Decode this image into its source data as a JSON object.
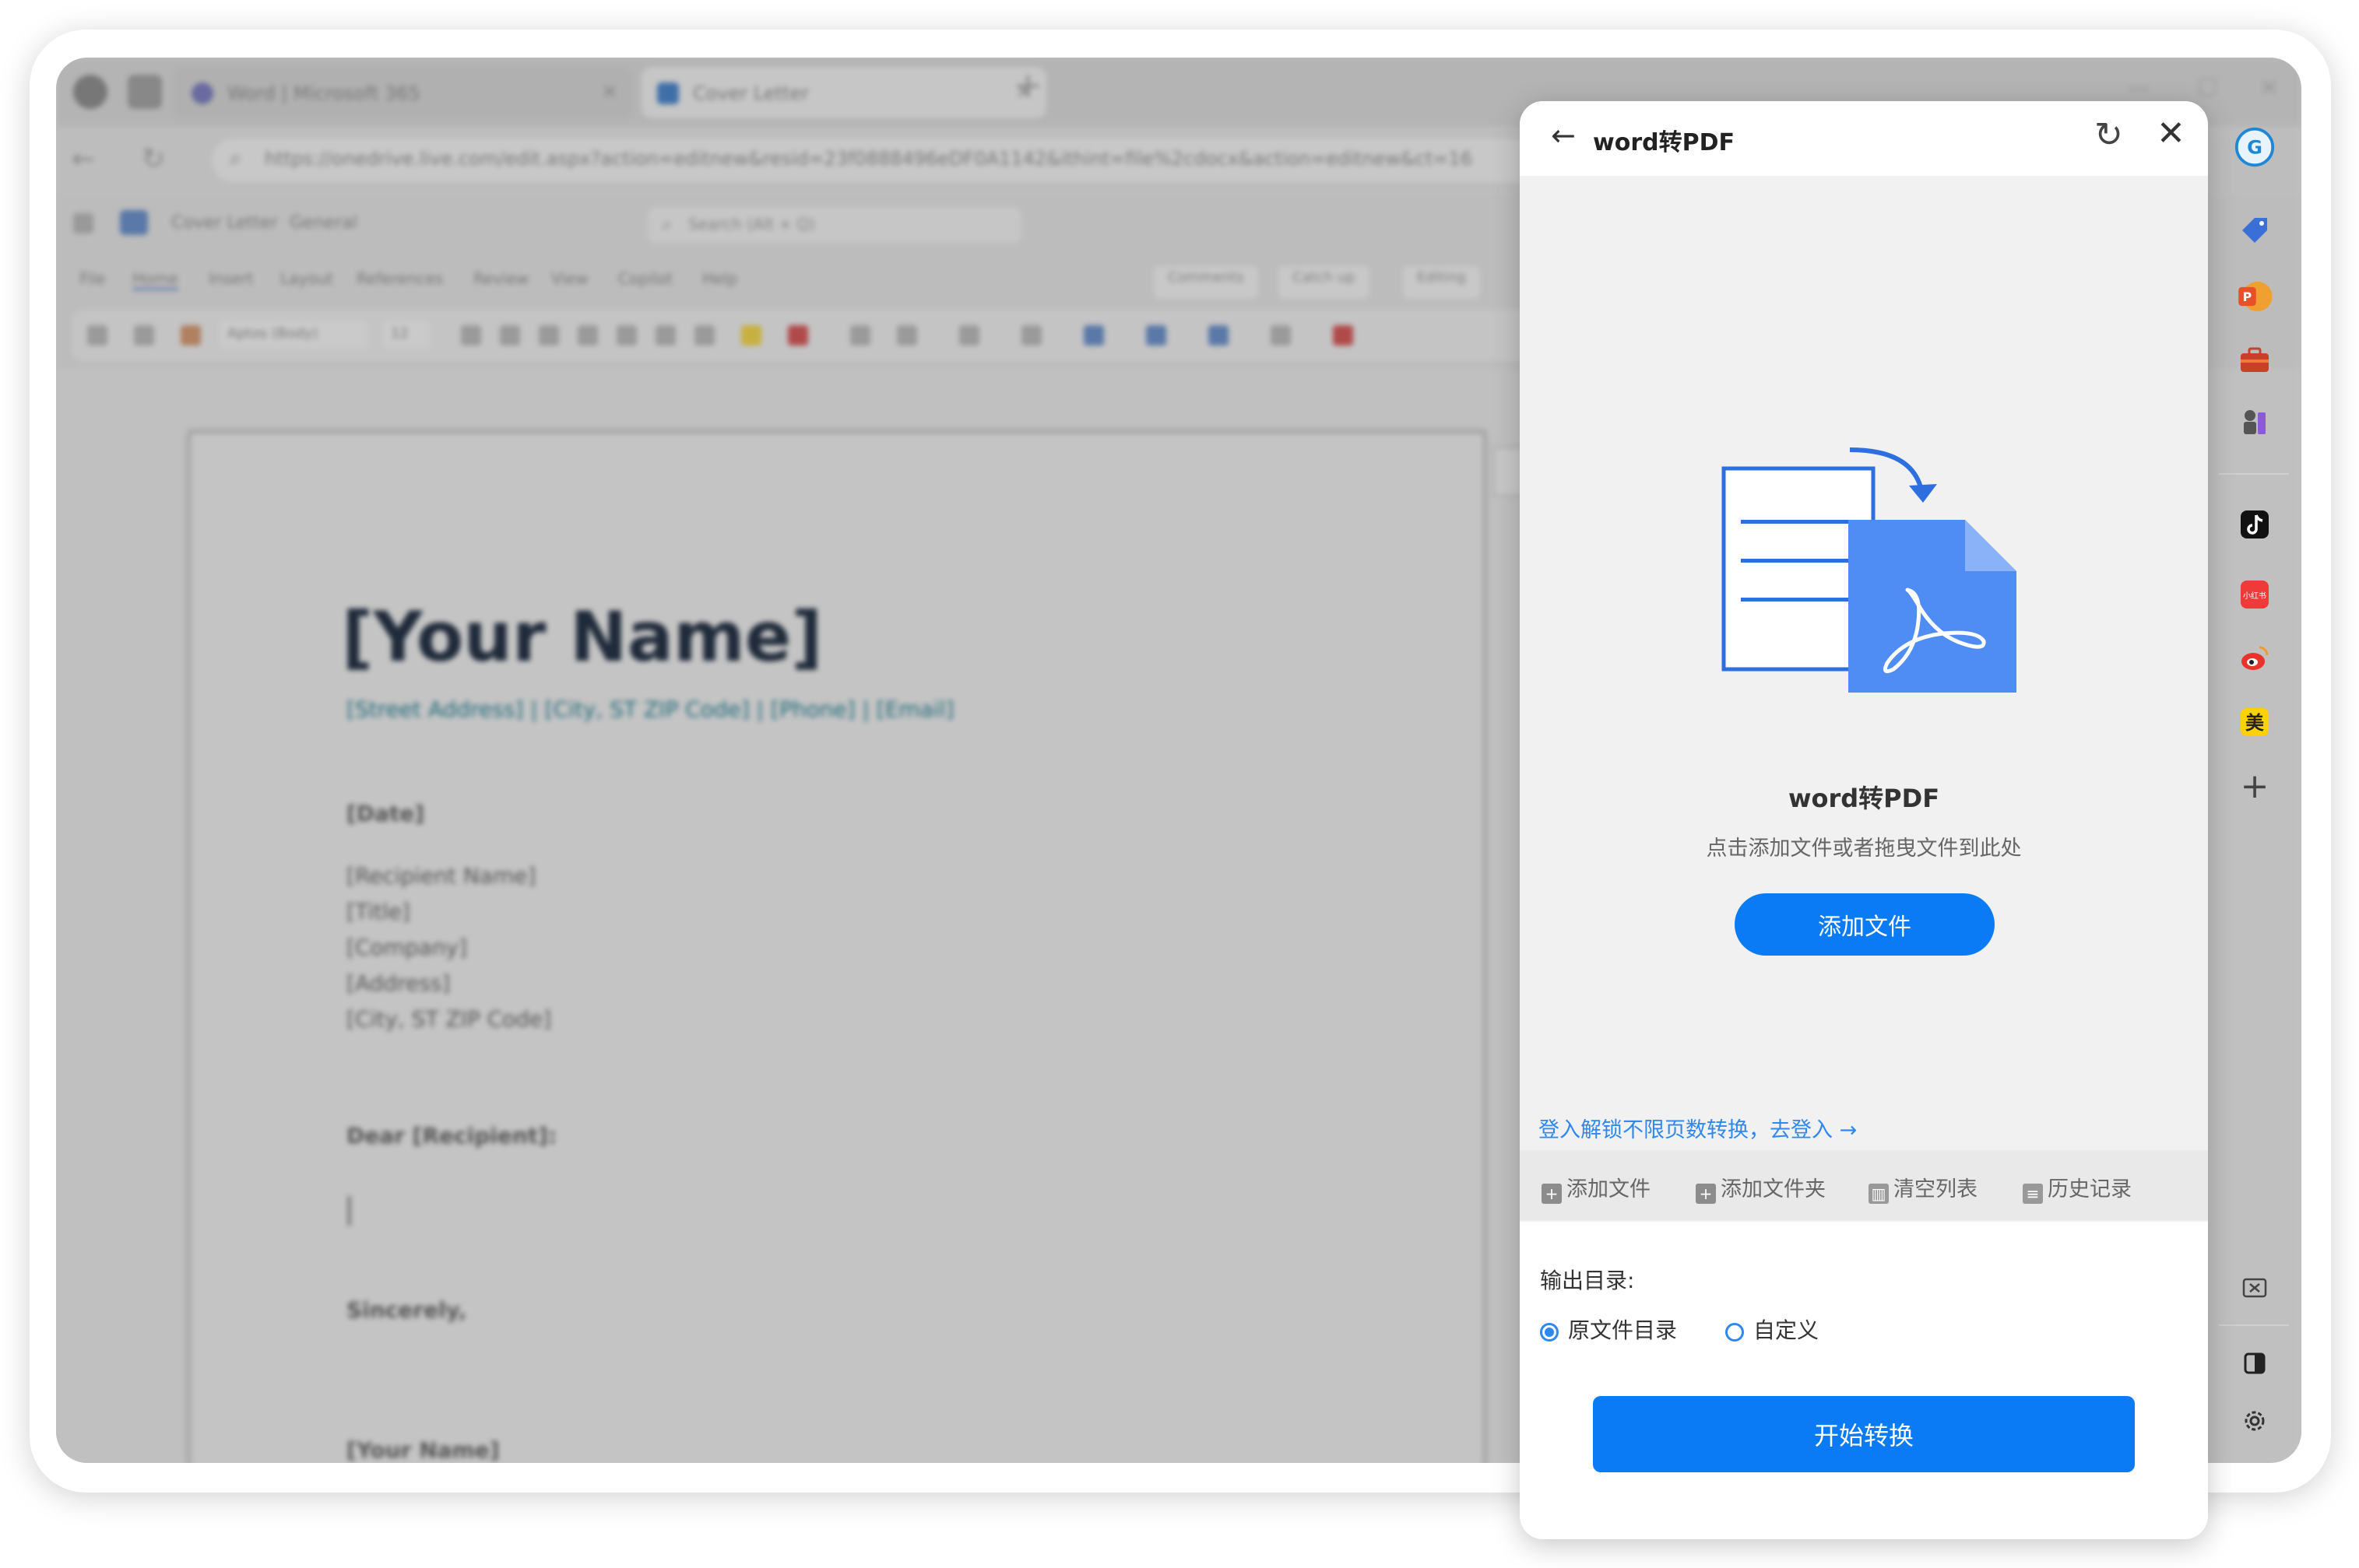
{
  "browser": {
    "tabs": [
      {
        "title": "Word | Microsoft 365"
      },
      {
        "title": "Cover Letter"
      }
    ],
    "new_tab": "+",
    "url": "https://onedrive.live.com/edit.aspx?action=editnew&resid=23f0888496eDF0A1142&ithint=file%2cdocx&action=editnew&ct=16"
  },
  "word": {
    "doc_title": "Cover Letter",
    "label": "General",
    "search_placeholder": "Search (Alt + Q)",
    "ribbon_tabs": [
      "File",
      "Home",
      "Insert",
      "Layout",
      "References",
      "Review",
      "View",
      "Copilot",
      "Help"
    ],
    "comments_label": "Comments",
    "catchup_label": "Catch up",
    "editing_label": "Editing",
    "font_name": "Aptos (Body)",
    "font_size": "12",
    "document": {
      "name": "[Your Name]",
      "contact": "[Street Address] | [City, ST ZIP Code] | [Phone] | [Email]",
      "date": "[Date]",
      "recipient_lines": [
        "[Recipient Name]",
        "[Title]",
        "[Company]",
        "[Address]",
        "[City, ST ZIP Code]"
      ],
      "salutation": "Dear [Recipient]:",
      "closing": "Sincerely,",
      "signature": "[Your Name]"
    }
  },
  "sidebar": {
    "icons": [
      "grammarly-icon",
      "tag-icon",
      "pdf-convert-icon",
      "toolbox-icon",
      "chess-icon",
      "tiktok-icon",
      "xiaohongshu-icon",
      "weibo-icon",
      "meituan-icon",
      "add-icon",
      "screenshot-icon",
      "theme-icon",
      "settings-icon"
    ],
    "meituan_label": "美",
    "xiaohongshu_label": "小红书",
    "pdf_label": "P"
  },
  "panel": {
    "title": "word转PDF",
    "drop_title": "word转PDF",
    "drop_hint": "点击添加文件或者拖曳文件到此处",
    "add_button": "添加文件",
    "login_link": "登入解锁不限页数转换，去登入 →",
    "actions": [
      {
        "label": "添加文件",
        "icon": "add-file-icon"
      },
      {
        "label": "添加文件夹",
        "icon": "add-folder-icon"
      },
      {
        "label": "清空列表",
        "icon": "trash-icon"
      },
      {
        "label": "历史记录",
        "icon": "history-icon"
      }
    ],
    "output_label": "输出目录:",
    "output_options": [
      {
        "label": "原文件目录",
        "checked": true
      },
      {
        "label": "自定义",
        "checked": false
      }
    ],
    "start_button": "开始转换"
  },
  "colors": {
    "accent": "#0a7bf5",
    "link": "#2f87f0",
    "pdf_blue": "#4f8df5"
  }
}
